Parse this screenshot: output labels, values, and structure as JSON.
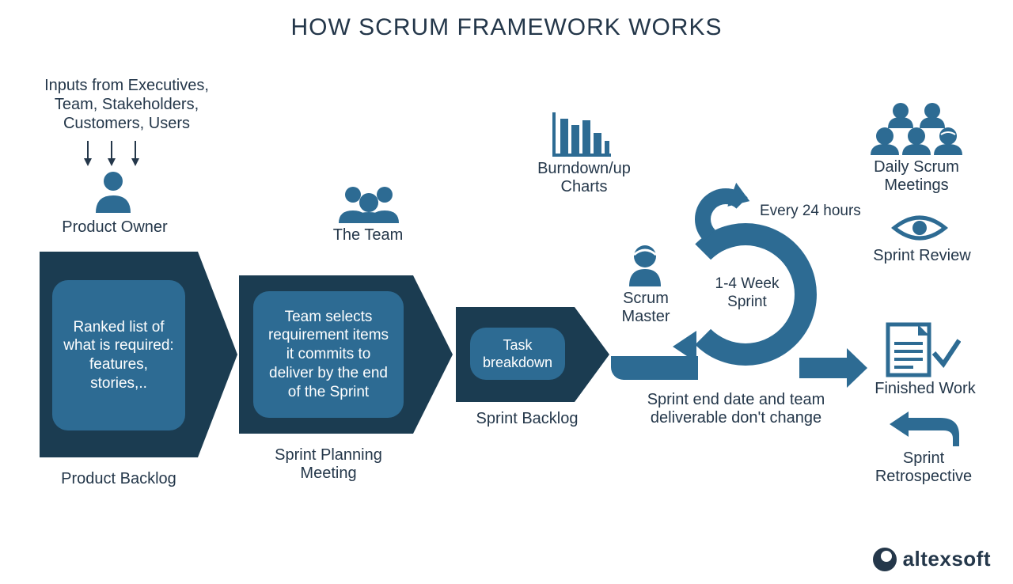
{
  "title": "HOW SCRUM FRAMEWORK WORKS",
  "inputs_label": "Inputs from Executives, Team, Stakeholders, Customers, Users",
  "product_owner": "Product Owner",
  "product_backlog": {
    "caption": "Product Backlog",
    "desc": "Ranked list of what is required: features, stories,.."
  },
  "the_team": "The Team",
  "sprint_planning": {
    "caption": "Sprint Planning Meeting",
    "desc": "Team selects requirement items it commits to deliver by the end of the Sprint"
  },
  "sprint_backlog": {
    "caption": "Sprint Backlog",
    "desc": "Task breakdown"
  },
  "burndown": "Burndown/up Charts",
  "scrum_master": "Scrum Master",
  "sprint_loop": {
    "daily": "Every 24 hours",
    "duration": "1-4 Week Sprint",
    "note": "Sprint end date and team deliverable don't change"
  },
  "daily_meetings": "Daily Scrum Meetings",
  "sprint_review": "Sprint Review",
  "finished_work": "Finished Work",
  "retrospective": "Sprint Retrospective",
  "brand": "altexsoft"
}
